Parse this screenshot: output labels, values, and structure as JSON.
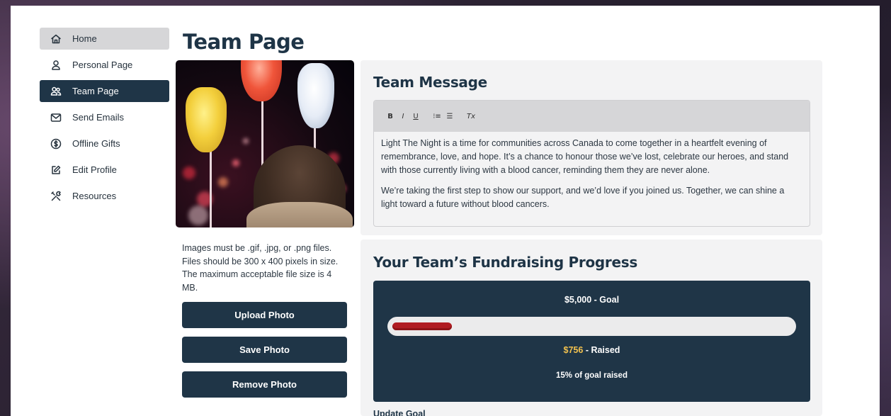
{
  "sidebar": {
    "items": [
      {
        "label": "Home",
        "icon": "home-icon"
      },
      {
        "label": "Personal Page",
        "icon": "user-icon"
      },
      {
        "label": "Team Page",
        "icon": "users-icon"
      },
      {
        "label": "Send Emails",
        "icon": "mail-icon"
      },
      {
        "label": "Offline Gifts",
        "icon": "dollar-icon"
      },
      {
        "label": "Edit Profile",
        "icon": "edit-icon"
      },
      {
        "label": "Resources",
        "icon": "tools-icon"
      }
    ],
    "active_item": "Team Page"
  },
  "page": {
    "title": "Team Page"
  },
  "photo": {
    "note": "Images must be .gif, .jpg, or .png files. Files should be 300 x 400 pixels in size. The maximum acceptable file size is 4 MB.",
    "upload_label": "Upload Photo",
    "save_label": "Save Photo",
    "remove_label": "Remove Photo"
  },
  "team_message": {
    "title": "Team Message",
    "toolbar": {
      "bold": "B",
      "italic": "I",
      "underline": "U",
      "ordered_list": "⁝≡",
      "bullet_list": "☰",
      "clear_format": "Tx"
    },
    "paragraphs": [
      "Light The Night is a time for communities across Canada to come together in a heartfelt evening of remembrance, love, and hope. It’s a chance to honour those we’ve lost, celebrate our heroes, and stand with those currently living with a blood cancer, reminding them they are never alone.",
      "We’re taking the first step to show our support, and we’d love if you joined us. Together, we can shine a light toward a future without blood cancers."
    ]
  },
  "fundraising": {
    "title": "Your Team’s Fundraising Progress",
    "goal_text": "$5,000 - Goal",
    "raised_amount": "$756",
    "raised_suffix": " - Raised",
    "percent_text": "15% of goal raised",
    "progress_fraction": 0.15,
    "update_goal_label": "Update Goal"
  },
  "colors": {
    "navy": "#1f3547",
    "progress_fill": "#b01c22",
    "raised_amount": "#f2c14e"
  }
}
